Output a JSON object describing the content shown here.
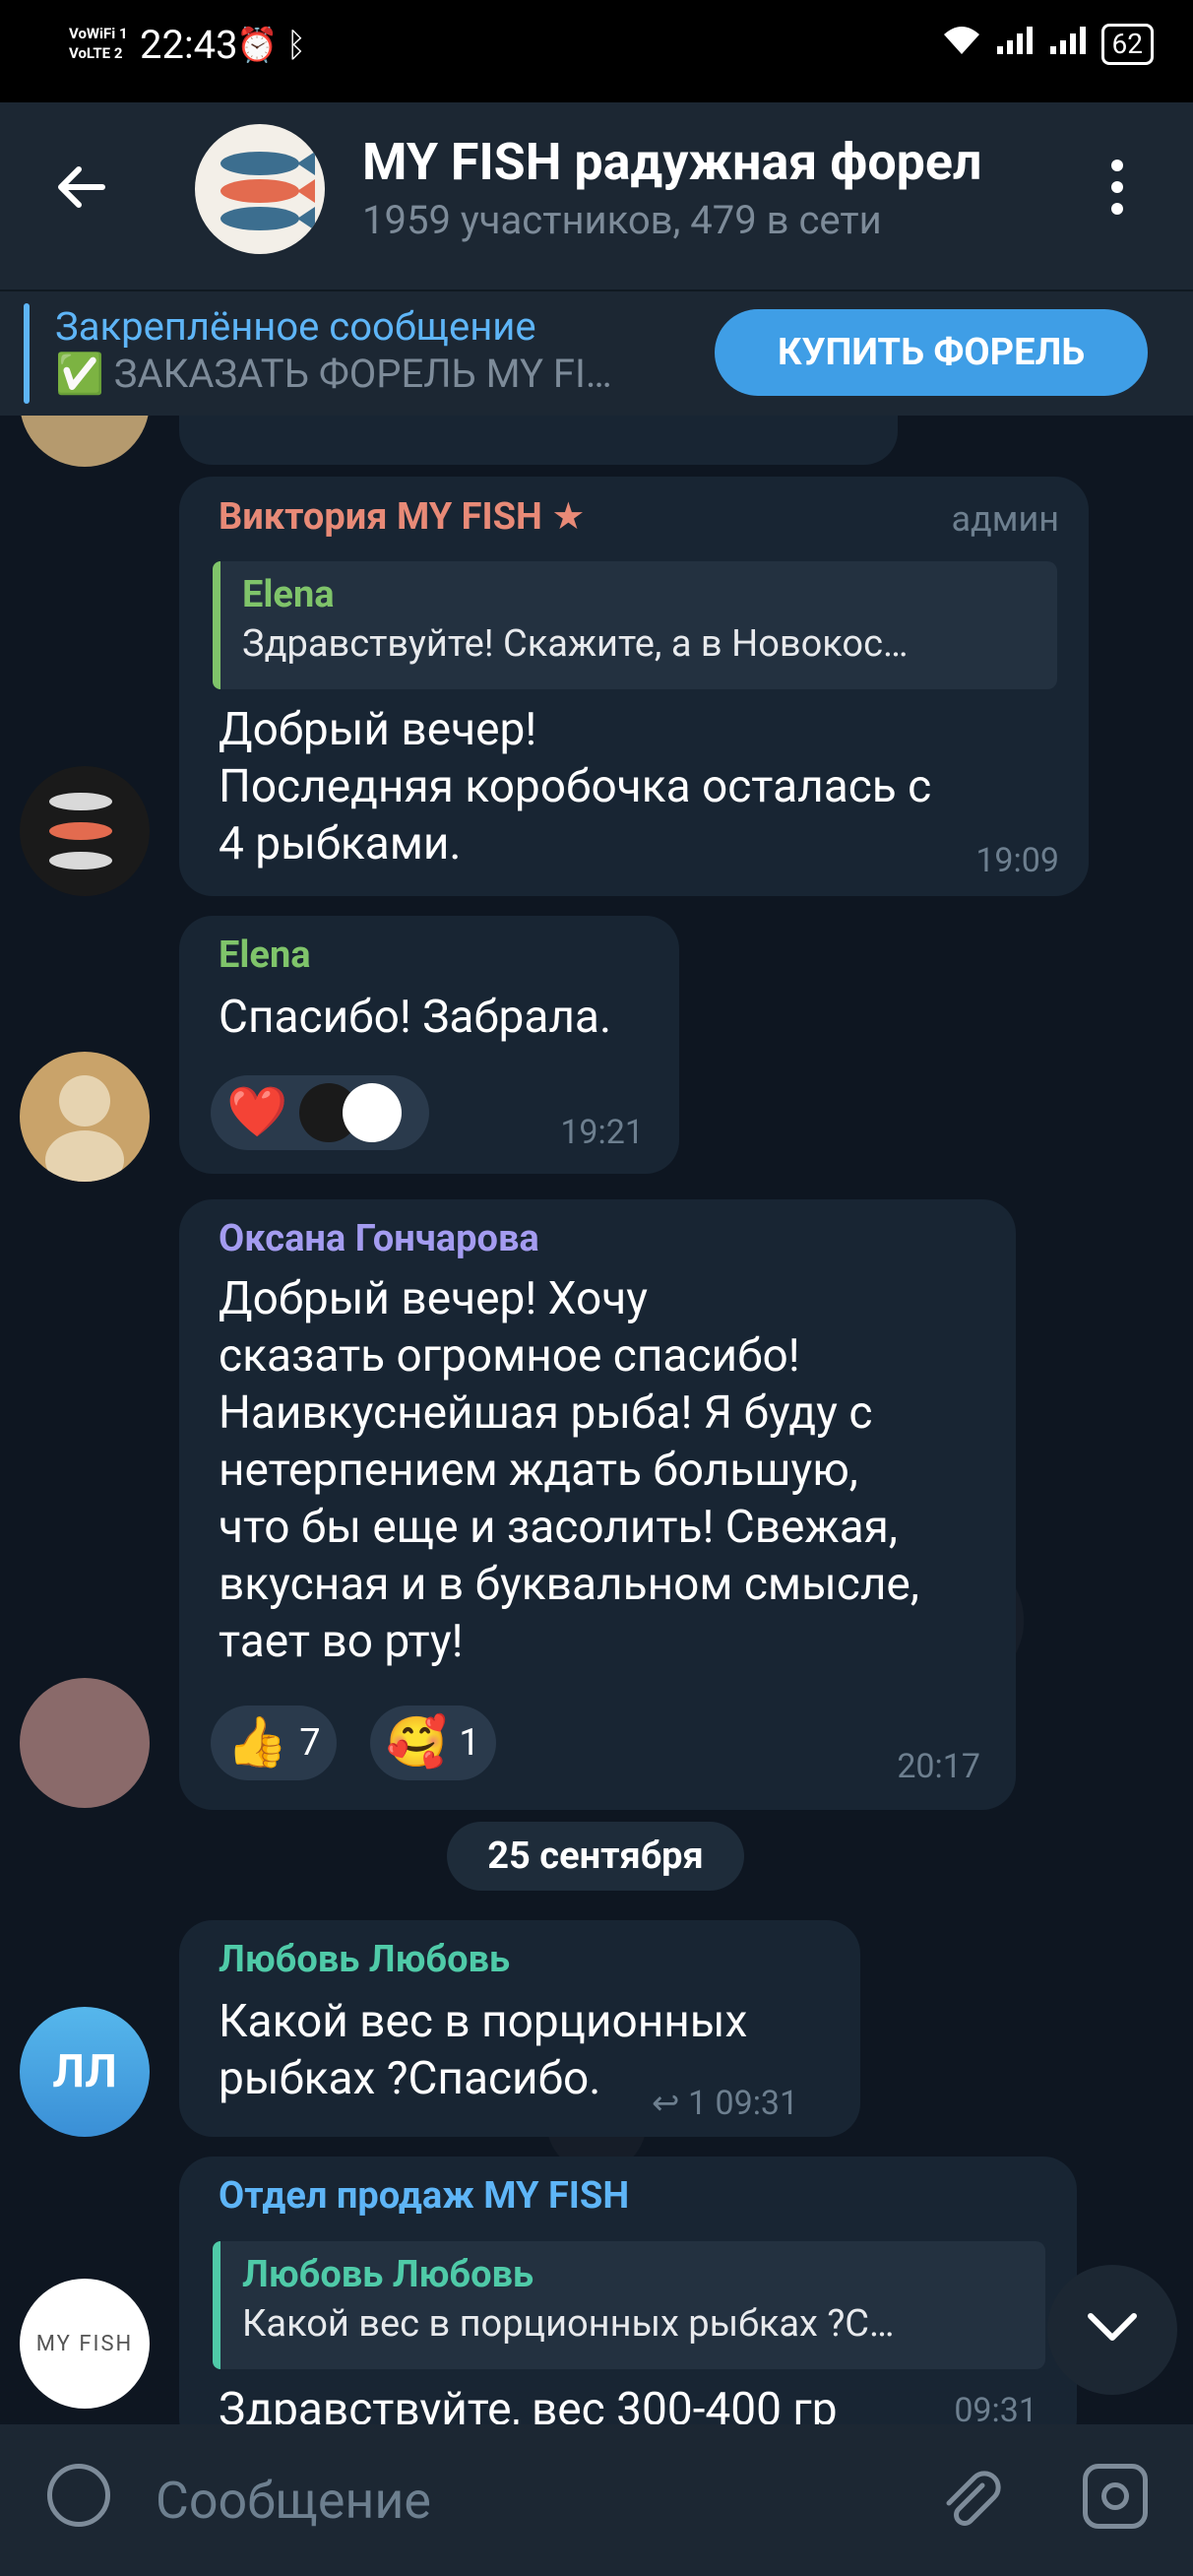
{
  "status": {
    "time": "22:43",
    "net1": "VoWiFi 1",
    "net2": "VoLTE 2",
    "battery": "62"
  },
  "header": {
    "title": "MY FISH радужная форел",
    "subtitle": "1959 участников, 479 в сети"
  },
  "pinned": {
    "title": "Закреплённое сообщение",
    "text": "✅ ЗАКАЗАТЬ ФОРЕЛЬ MY FI…",
    "button": "КУПИТЬ ФОРЕЛЬ"
  },
  "messages": [
    {
      "name": "Виктория MY FISH",
      "role": "админ",
      "quote": {
        "name": "Elena",
        "text": "Здравствуйте! Скажите, а в Новокос…"
      },
      "text": "Добрый вечер!\nПоследняя коробочка осталась с\n4 рыбками.",
      "time": "19:09"
    },
    {
      "name": "Elena",
      "text": "Спасибо! Забрала.",
      "time": "19:21"
    },
    {
      "name": "Оксана Гончарова",
      "text": "Добрый вечер! Хочу\nсказать огромное спасибо!\nНаивкуснейшая рыба! Я буду с\nнетерпением ждать большую,\nчто бы еще и засолить! Свежая,\nвкусная и в буквальном смысле,\nтает во рту!",
      "reactions": [
        {
          "emoji": "👍",
          "count": "7"
        },
        {
          "emoji": "🥰",
          "count": "1"
        }
      ],
      "time": "20:17"
    },
    {
      "name": "Любовь Любовь",
      "initials": "ЛЛ",
      "text": "Какой вес в порционных\nрыбках ?Спасибо.",
      "replies": "1",
      "time": "09:31"
    },
    {
      "name": "Отдел продаж MY FISH",
      "avatar_text": "MY FISH",
      "quote": {
        "name": "Любовь Любовь",
        "text": "Какой вес в порционных рыбках ?С…"
      },
      "text": "Здравствуйте, вес 300-400 гр",
      "time": "09:31"
    }
  ],
  "date_separator": "25 сентября",
  "input": {
    "placeholder": "Сообщение"
  },
  "colors": {
    "accent": "#5eb5f7",
    "name_viktoria": "#e88a77",
    "name_elena": "#7fc46a",
    "name_oksana": "#a49cf0",
    "name_lyubov": "#4fcaa8",
    "name_sales": "#5eb5f7"
  }
}
